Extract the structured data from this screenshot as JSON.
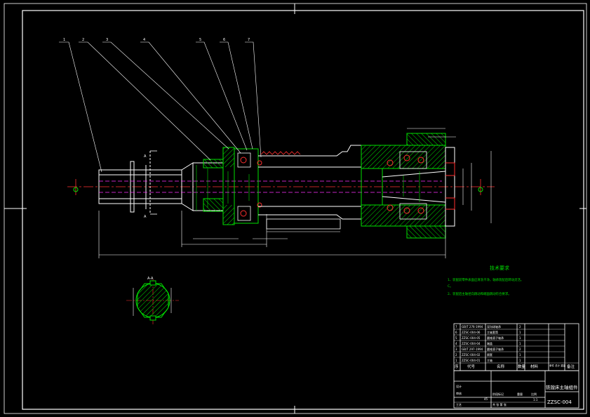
{
  "balloons": [
    "1",
    "2",
    "3",
    "4",
    "5",
    "6",
    "7"
  ],
  "section_label": "A-A",
  "section_marks": [
    "A",
    "A"
  ],
  "tech_requirements": {
    "title": "技术要求",
    "line1": "1、装配前零件表面应清洗干净，轴承装配后转动灵活。",
    "line1b": "C。",
    "line2": "2、装配后主轴径向跳动和端面跳动符合要求。"
  },
  "title_block": {
    "header_seq": "序",
    "header_code": "代号",
    "header_name": "名称",
    "header_qty": "数量",
    "header_material": "材料",
    "header_weight": "单件 总计 重量",
    "header_remarks": "备注",
    "drawing_name": "铣镗床主轴组件",
    "drawing_code": "ZZSC-004",
    "material": "45",
    "scale": "1:1",
    "row_design": "设计",
    "row_check": "审核",
    "row_process": "工艺",
    "label_stage": "阶段标记",
    "label_weight": "重量",
    "label_scale": "比例",
    "label_sheet": "共 张 第 张",
    "bom_rows": [
      {
        "seq": "7",
        "code": "GB/T 276-1994",
        "name": "深沟球轴承",
        "qty": "2"
      },
      {
        "seq": "6",
        "code": "ZZSC-004-06",
        "name": "主轴套筒",
        "qty": "1"
      },
      {
        "seq": "5",
        "code": "ZZSC-004-05",
        "name": "圆锥滚子轴承",
        "qty": "1"
      },
      {
        "seq": "4",
        "code": "ZZSC-004-04",
        "name": "端盖",
        "qty": "1"
      },
      {
        "seq": "3",
        "code": "GB/T 297-1994",
        "name": "圆锥滚子轴承",
        "qty": "2"
      },
      {
        "seq": "2",
        "code": "ZZSC-004-02",
        "name": "隔套",
        "qty": "1"
      },
      {
        "seq": "1",
        "code": "ZZSC-004-01",
        "name": "主轴",
        "qty": "1"
      }
    ]
  }
}
